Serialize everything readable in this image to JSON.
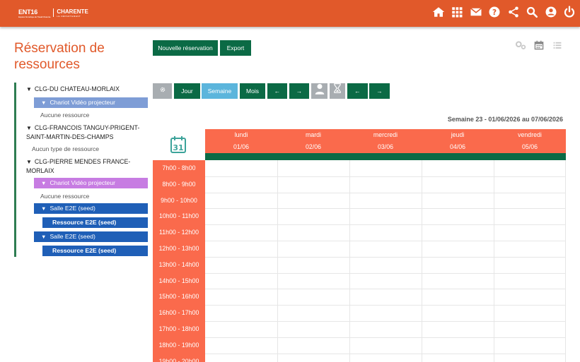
{
  "header": {
    "logo_ent": "ENT16",
    "logo_ent_sub": "Espace Numérique de Travail Charente",
    "logo_charente": "CHARENTE",
    "logo_charente_sub": "LE DÉPARTEMENT",
    "icons": [
      "home-icon",
      "apps-icon",
      "mail-icon",
      "help-icon",
      "share-icon",
      "search-icon",
      "account-icon",
      "power-icon"
    ]
  },
  "page_title": "Réservation de ressources",
  "actions": {
    "new_reservation": "Nouvelle réservation",
    "export": "Export"
  },
  "tree": {
    "school1": "CLG-DU CHATEAU-MORLAIX",
    "school1_type": "Chariot Vidéo projecteur",
    "school1_note": "Aucune ressource",
    "school2": "CLG-FRANCOIS TANGUY-PRIGENT-SAINT-MARTIN-DES-CHAMPS",
    "school2_note": "Aucun type de ressource",
    "school3": "CLG-PIERRE MENDES FRANCE-MORLAIX",
    "school3_type1": "Chariot Vidéo projecteur",
    "school3_note": "Aucune ressource",
    "school3_type2": "Salle E2E (seed)",
    "school3_res2": "Ressource E2E (seed)",
    "school3_type3": "Salle E2E (seed)",
    "school3_res3": "Ressource E2E (seed)",
    "triangle": "▼"
  },
  "toolbar": {
    "settings_icon": "gear-icon",
    "day": "Jour",
    "week": "Semaine",
    "month": "Mois",
    "prev": "←",
    "next": "→",
    "user_icon": "user-icon",
    "hourglass_icon": "hourglass-icon",
    "prev2": "←",
    "next2": "→"
  },
  "week_label": "Semaine 23 - 01/06/2026 au 07/06/2026",
  "days": [
    {
      "name": "lundi",
      "date": "01/06"
    },
    {
      "name": "mardi",
      "date": "02/06"
    },
    {
      "name": "mercredi",
      "date": "03/06"
    },
    {
      "name": "jeudi",
      "date": "04/06"
    },
    {
      "name": "vendredi",
      "date": "05/06"
    }
  ],
  "hours": [
    "7h00 - 8h00",
    "8h00 - 9h00",
    "9h00 - 10h00",
    "10h00 - 11h00",
    "11h00 - 12h00",
    "12h00 - 13h00",
    "13h00 - 14h00",
    "14h00 - 15h00",
    "15h00 - 16h00",
    "16h00 - 17h00",
    "17h00 - 18h00",
    "18h00 - 19h00",
    "19h00 - 20h00"
  ],
  "colors": {
    "header": "#e1592a",
    "primary_green": "#0b6a45",
    "day_header": "#fa6a4c",
    "active_tab": "#5bb5dc"
  }
}
